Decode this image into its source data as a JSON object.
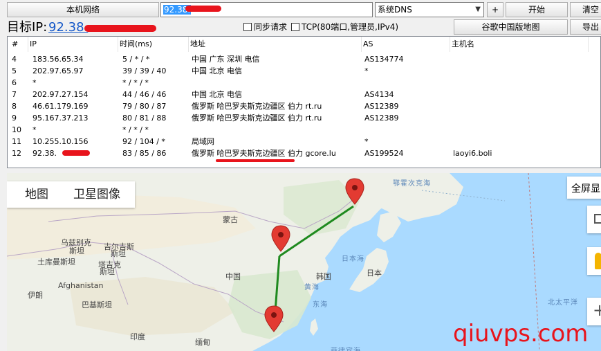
{
  "toolbar": {
    "local_network_label": "本机网络",
    "ip_input_value": "92.38.",
    "dns_select_value": "系统DNS",
    "add_label": "+",
    "start_label": "开始",
    "clear_label": "清空",
    "export_label": "导出",
    "google_map_label": "谷歌中国版地图"
  },
  "target": {
    "label": "目标IP:",
    "ip": "92.38."
  },
  "options": {
    "sync_request": "同步请求",
    "tcp_mode": "TCP(80端口,管理员,IPv4)"
  },
  "table": {
    "headers": [
      "#",
      "IP",
      "时间(ms)",
      "地址",
      "AS",
      "主机名"
    ],
    "rows": [
      {
        "n": "4",
        "ip": "183.56.65.34",
        "time": "5 / * / *",
        "addr": "中国 广东 深圳 电信",
        "as": "AS134774",
        "host": ""
      },
      {
        "n": "5",
        "ip": "202.97.65.97",
        "time": "39 / 39 / 40",
        "addr": "中国 北京 电信",
        "as": "*",
        "host": ""
      },
      {
        "n": "6",
        "ip": "*",
        "time": "* / * / *",
        "addr": "",
        "as": "",
        "host": ""
      },
      {
        "n": "7",
        "ip": "202.97.27.154",
        "time": "44 / 46 / 46",
        "addr": "中国 北京 电信",
        "as": "AS4134",
        "host": ""
      },
      {
        "n": "8",
        "ip": "46.61.179.169",
        "time": "79 / 80 / 87",
        "addr": "俄罗斯 哈巴罗夫斯克边疆区 伯力 rt.ru",
        "as": "AS12389",
        "host": ""
      },
      {
        "n": "9",
        "ip": "95.167.37.213",
        "time": "80 / 81 / 88",
        "addr": "俄罗斯 哈巴罗夫斯克边疆区 伯力 rt.ru",
        "as": "AS12389",
        "host": ""
      },
      {
        "n": "10",
        "ip": "*",
        "time": "* / * / *",
        "addr": "",
        "as": "",
        "host": ""
      },
      {
        "n": "11",
        "ip": "10.255.10.156",
        "time": "92 / 104 / *",
        "addr": "局域网",
        "as": "*",
        "host": ""
      },
      {
        "n": "12",
        "ip": "92.38.",
        "time": "83 / 85 / 86",
        "addr": "俄罗斯 哈巴罗夫斯克边疆区 伯力 gcore.lu",
        "as": "AS199524",
        "host": "laoyi6.boli"
      }
    ]
  },
  "map": {
    "tab_map": "地图",
    "tab_satellite": "卫星图像",
    "fullscreen": "全屏显",
    "labels": {
      "okhotsk": "鄂霍次克海",
      "mongolia": "蒙古",
      "uzbekistan": "乌兹别克",
      "uzbekistan2": "斯坦",
      "kyrgyz": "吉尔吉斯",
      "kyrgyz2": "斯坦",
      "turkmenistan": "土库曼斯坦",
      "tajik": "塔吉克",
      "tajik2": "斯坦",
      "japan_sea": "日本海",
      "japan": "日本",
      "korea": "韩国",
      "china": "中国",
      "yellow_sea": "黄海",
      "east_sea": "东海",
      "afghanistan": "Afghanistan",
      "iran": "伊朗",
      "pakistan": "巴基斯坦",
      "pacific": "北太平洋",
      "india": "印度",
      "myanmar": "缅甸",
      "philippine_sea": "菲律宾海"
    }
  },
  "watermark": "qiuvps.com",
  "colors": {
    "route": "#1f8a1f",
    "marker": "#e33b32",
    "redact": "#e8141c",
    "link": "#1558c8"
  }
}
